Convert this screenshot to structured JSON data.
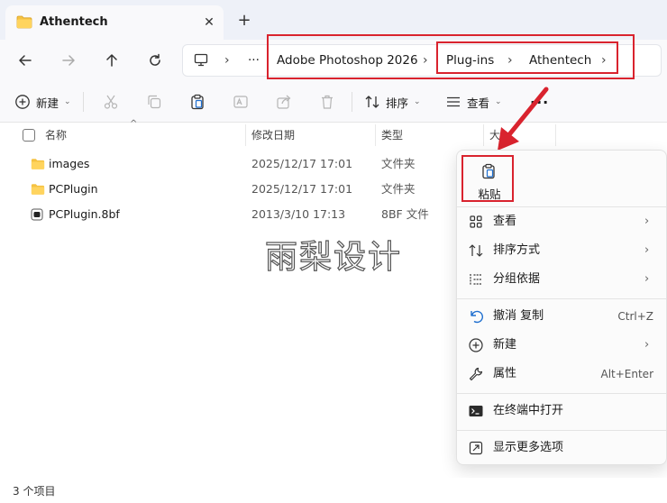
{
  "window": {
    "tab_title": "Athentech",
    "new_tab_label": "+",
    "close_label": "✕"
  },
  "address": {
    "more_label": "···",
    "segments": [
      "Adobe Photoshop 2026",
      "Plug-ins",
      "Athentech"
    ]
  },
  "toolbar": {
    "new_label": "新建",
    "sort_label": "排序",
    "view_label": "查看",
    "more_label": "···"
  },
  "columns": {
    "name": "名称",
    "date": "修改日期",
    "type": "类型",
    "size": "大"
  },
  "files": [
    {
      "name": "images",
      "date": "2025/12/17 17:01",
      "type": "文件夹",
      "icon": "folder-icon"
    },
    {
      "name": "PCPlugin",
      "date": "2025/12/17 17:01",
      "type": "文件夹",
      "icon": "folder-icon"
    },
    {
      "name": "PCPlugin.8bf",
      "date": "2013/3/10 17:13",
      "type": "8BF 文件",
      "icon": "plugin-file-icon"
    }
  ],
  "watermark": "雨梨设计",
  "context_menu": {
    "paste_label": "粘贴",
    "items": [
      {
        "label": "查看",
        "shortcut": "",
        "submenu": true,
        "icon": "grid-view-icon"
      },
      {
        "label": "排序方式",
        "shortcut": "",
        "submenu": true,
        "icon": "sort-icon"
      },
      {
        "label": "分组依据",
        "shortcut": "",
        "submenu": true,
        "icon": "group-icon"
      },
      {
        "label": "撤消 复制",
        "shortcut": "Ctrl+Z",
        "submenu": false,
        "icon": "undo-icon"
      },
      {
        "label": "新建",
        "shortcut": "",
        "submenu": true,
        "icon": "new-icon"
      },
      {
        "label": "属性",
        "shortcut": "Alt+Enter",
        "submenu": false,
        "icon": "wrench-icon"
      },
      {
        "label": "在终端中打开",
        "shortcut": "",
        "submenu": false,
        "icon": "terminal-icon"
      },
      {
        "label": "显示更多选项",
        "shortcut": "",
        "submenu": false,
        "icon": "more-options-icon"
      }
    ]
  },
  "status": {
    "item_count": "3 个项目"
  },
  "colors": {
    "annotation_red": "#d9232e",
    "folder_yellow": "#f5c242",
    "accent_blue": "#1f6fcf"
  }
}
